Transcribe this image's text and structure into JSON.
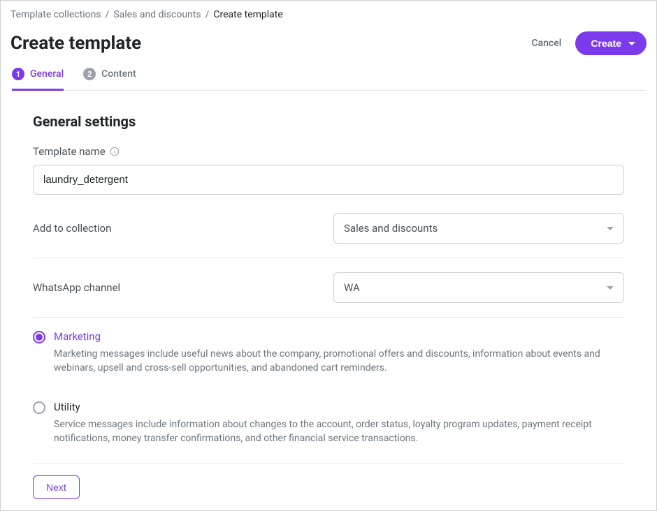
{
  "breadcrumb": {
    "items": [
      "Template collections",
      "Sales and discounts"
    ],
    "current": "Create template"
  },
  "header": {
    "title": "Create template",
    "cancel": "Cancel",
    "create": "Create"
  },
  "tabs": [
    {
      "num": "1",
      "label": "General",
      "active": true
    },
    {
      "num": "2",
      "label": "Content",
      "active": false
    }
  ],
  "section": {
    "title": "General settings",
    "template_name_label": "Template name",
    "template_name_value": "laundry_detergent",
    "collection_label": "Add to collection",
    "collection_value": "Sales and discounts",
    "channel_label": "WhatsApp channel",
    "channel_value": "WA"
  },
  "radios": [
    {
      "title": "Marketing",
      "desc": "Marketing messages include useful news about the company, promotional offers and discounts, information about events and webinars, upsell and cross-sell opportunities, and abandoned cart reminders.",
      "selected": true
    },
    {
      "title": "Utility",
      "desc": "Service messages include information about changes to the account, order status, loyalty program updates, payment receipt notifications, money transfer confirmations, and other financial service transactions.",
      "selected": false
    }
  ],
  "next_label": "Next"
}
